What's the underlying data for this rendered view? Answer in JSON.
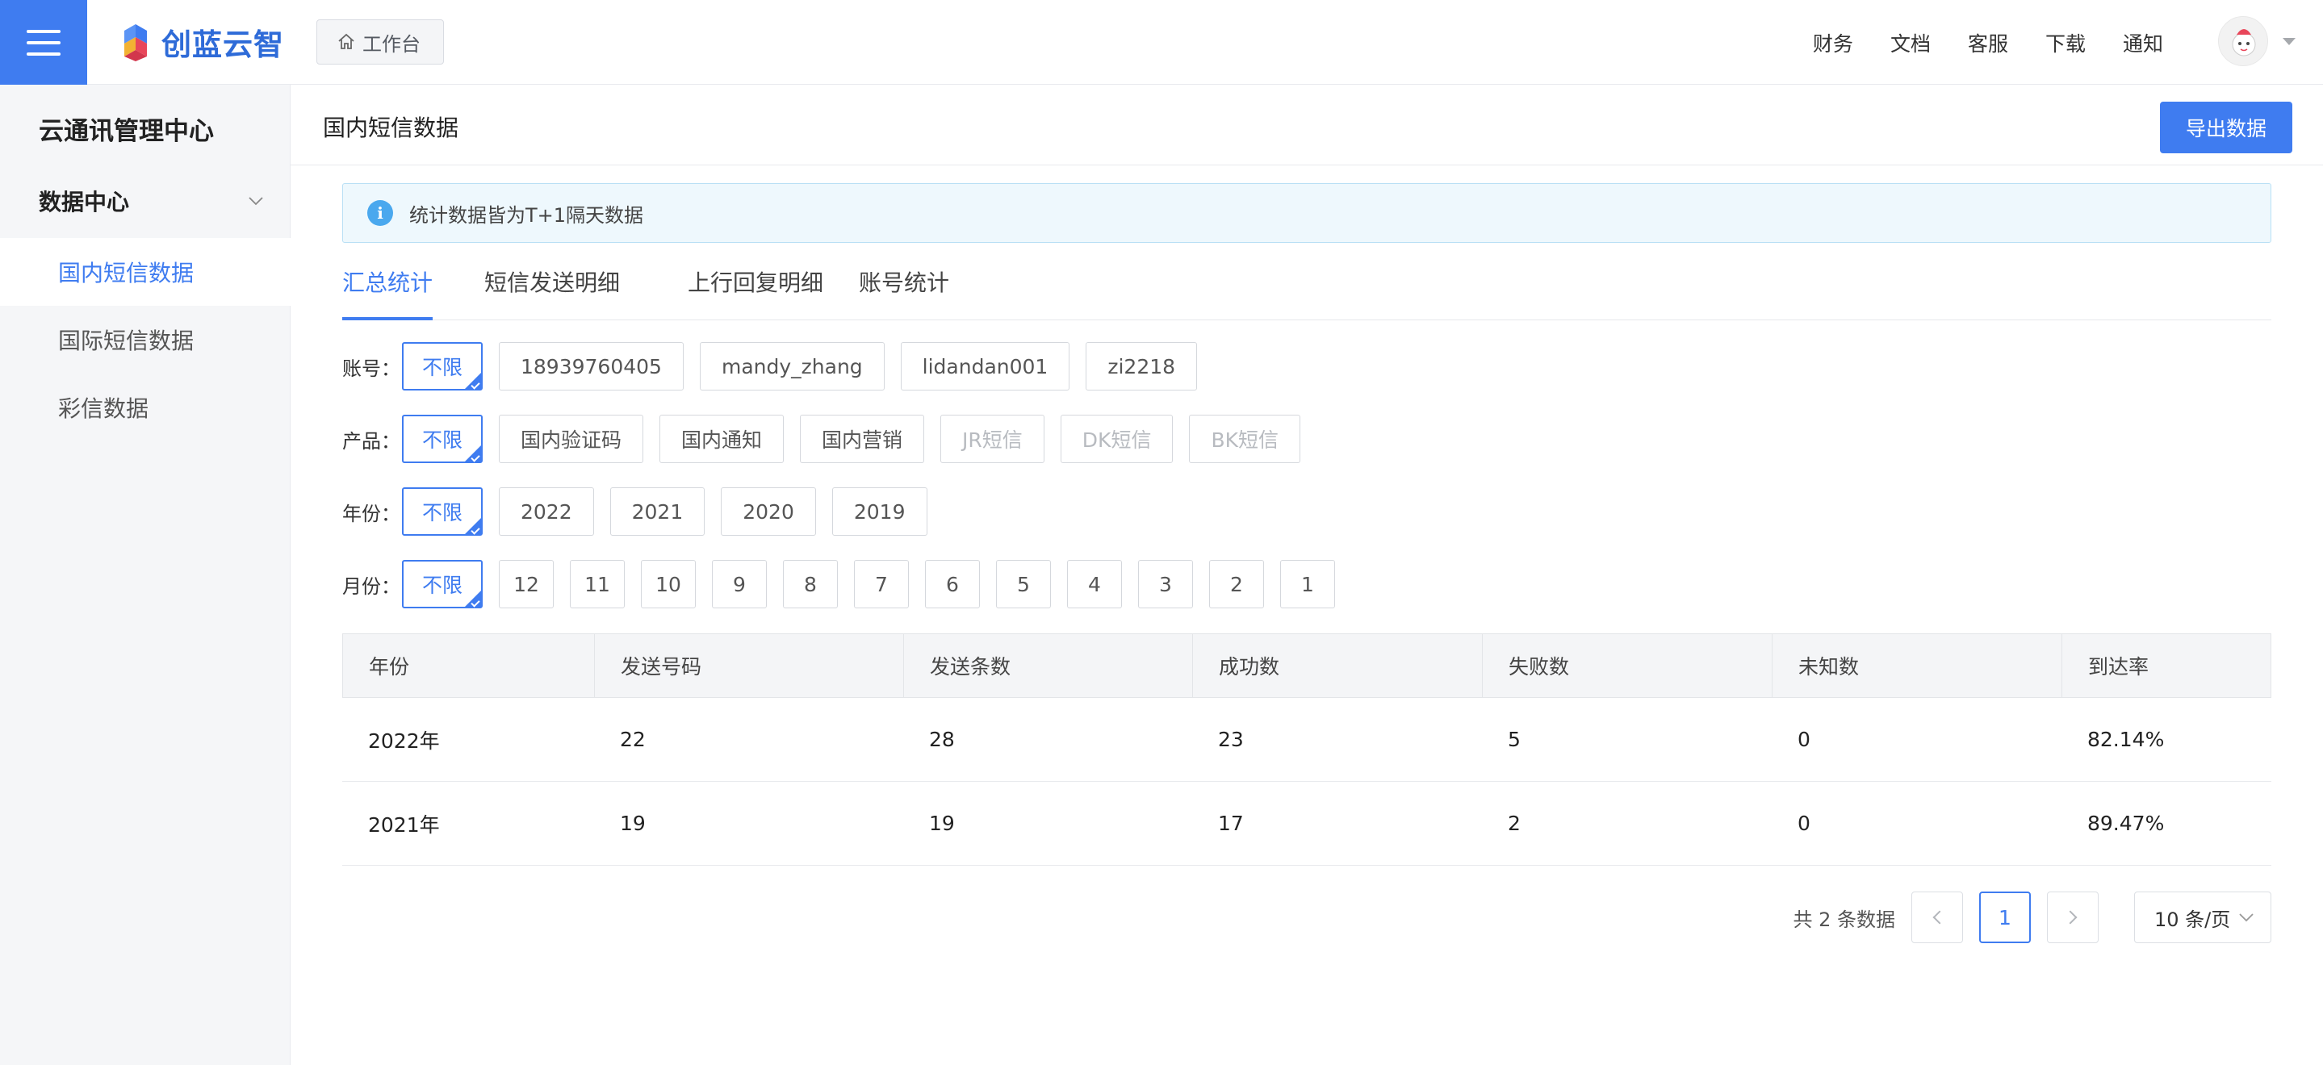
{
  "header": {
    "brand": "创蓝云智",
    "workbench_label": "工作台",
    "nav": [
      "财务",
      "文档",
      "客服",
      "下载",
      "通知"
    ]
  },
  "sidebar": {
    "title": "云通讯管理中心",
    "group_label": "数据中心",
    "items": [
      {
        "label": "国内短信数据",
        "active": true
      },
      {
        "label": "国际短信数据",
        "active": false
      },
      {
        "label": "彩信数据",
        "active": false
      }
    ]
  },
  "page": {
    "title": "国内短信数据",
    "export_label": "导出数据",
    "notice": "统计数据皆为T+1隔天数据"
  },
  "tabs": [
    "汇总统计",
    "短信发送明细",
    "上行回复明细",
    "账号统计"
  ],
  "filters": {
    "account": {
      "label": "账号：",
      "options": [
        "不限",
        "18939760405",
        "mandy_zhang",
        "lidandan001",
        "zi2218"
      ]
    },
    "product": {
      "label": "产品：",
      "options": [
        "不限",
        "国内验证码",
        "国内通知",
        "国内营销",
        "JR短信",
        "DK短信",
        "BK短信"
      ]
    },
    "year": {
      "label": "年份：",
      "options": [
        "不限",
        "2022",
        "2021",
        "2020",
        "2019"
      ]
    },
    "month": {
      "label": "月份：",
      "options": [
        "不限",
        "12",
        "11",
        "10",
        "9",
        "8",
        "7",
        "6",
        "5",
        "4",
        "3",
        "2",
        "1"
      ]
    }
  },
  "table": {
    "columns": [
      "年份",
      "发送号码",
      "发送条数",
      "成功数",
      "失败数",
      "未知数",
      "到达率"
    ],
    "rows": [
      [
        "2022年",
        "22",
        "28",
        "23",
        "5",
        "0",
        "82.14%"
      ],
      [
        "2021年",
        "19",
        "19",
        "17",
        "2",
        "0",
        "89.47%"
      ]
    ]
  },
  "pagination": {
    "total_text": "共 2 条数据",
    "current_page": "1",
    "page_size": "10 条/页"
  },
  "colors": {
    "accent": "#3f7cf0",
    "notice_bg": "#eef8fd",
    "info_icon": "#4aa8ee"
  }
}
